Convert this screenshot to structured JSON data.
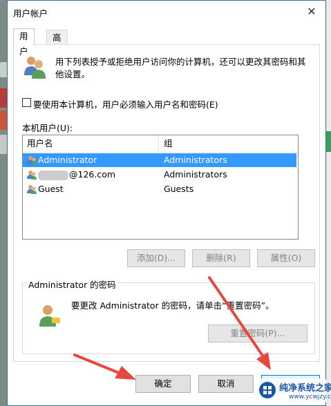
{
  "window": {
    "title": "用户帐户",
    "close_glyph": "✕"
  },
  "tabs": [
    {
      "label": "用户",
      "active": true
    },
    {
      "label": "高级",
      "active": false
    }
  ],
  "intro_text": "用下列表授予或拒绝用户访问你的计算机，还可以更改其密码和其他设置。",
  "require_login": {
    "label": "要使用本计算机，用户必须输入用户名和密码(E)",
    "checked": false
  },
  "users_list": {
    "label": "本机用户(U):",
    "columns": [
      "用户名",
      "组"
    ],
    "rows": [
      {
        "name": "Administrator",
        "group": "Administrators",
        "selected": true
      },
      {
        "name": "@126.com",
        "group": "Administrators",
        "selected": false,
        "name_partially_hidden": true
      },
      {
        "name": "Guest",
        "group": "Guests",
        "selected": false
      }
    ]
  },
  "list_buttons": {
    "add": "添加(D)...",
    "remove": "删除(R)",
    "properties": "属性(O)"
  },
  "password_group": {
    "title": "Administrator 的密码",
    "text": "要更改 Administrator 的密码，请单击“重置密码”。",
    "reset_button": "重置密码(P)..."
  },
  "footer_buttons": {
    "ok": "确定",
    "cancel": "取消",
    "apply": ""
  },
  "watermark": {
    "title": "纯净系统之家",
    "url": "www.ycwjzy.com"
  },
  "colors": {
    "selection": "#3399ff",
    "annotation_arrow": "#e8473c",
    "accent": "#0078d7"
  },
  "icons": {
    "users": "users-icon",
    "user": "user-icon",
    "key": "user-key-icon",
    "logo": "windows-logo-icon"
  }
}
